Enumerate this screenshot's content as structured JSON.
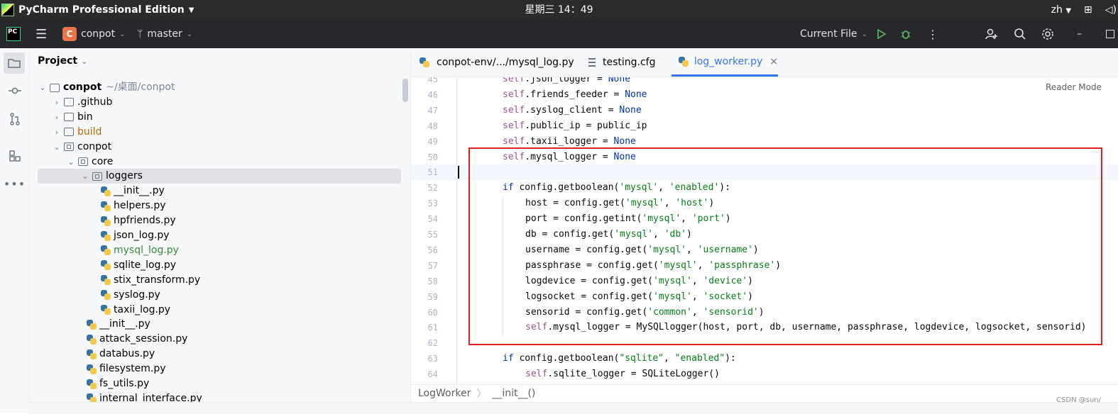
{
  "system_bar": {
    "app_title": "PyCharm Professional Edition",
    "clock": "星期三 14：49",
    "lang": "zh"
  },
  "toolbar": {
    "project_badge": "C",
    "project_name": "conpot",
    "branch": "master",
    "run_config": "Current File"
  },
  "project_panel": {
    "title": "Project",
    "tree": [
      {
        "label": "conpot",
        "note": "~/桌面/conpot",
        "kind": "folder",
        "level": 0,
        "state": "open"
      },
      {
        "label": ".github",
        "kind": "folder",
        "level": 1,
        "state": "closed"
      },
      {
        "label": "bin",
        "kind": "folder",
        "level": 1,
        "state": "closed"
      },
      {
        "label": "build",
        "kind": "folder",
        "level": 1,
        "state": "closed",
        "style": "orange"
      },
      {
        "label": "conpot",
        "kind": "package",
        "level": 1,
        "state": "open"
      },
      {
        "label": "core",
        "kind": "package",
        "level": 2,
        "state": "open"
      },
      {
        "label": "loggers",
        "kind": "package",
        "level": 3,
        "state": "open",
        "selected": true
      },
      {
        "label": "__init__.py",
        "kind": "py",
        "level": 4
      },
      {
        "label": "helpers.py",
        "kind": "py",
        "level": 4
      },
      {
        "label": "hpfriends.py",
        "kind": "py",
        "level": 4
      },
      {
        "label": "json_log.py",
        "kind": "py",
        "level": 4
      },
      {
        "label": "mysql_log.py",
        "kind": "py",
        "level": 4,
        "style": "green"
      },
      {
        "label": "sqlite_log.py",
        "kind": "py",
        "level": 4
      },
      {
        "label": "stix_transform.py",
        "kind": "py",
        "level": 4
      },
      {
        "label": "syslog.py",
        "kind": "py",
        "level": 4
      },
      {
        "label": "taxii_log.py",
        "kind": "py",
        "level": 4
      },
      {
        "label": "__init__.py",
        "kind": "py",
        "level": 3
      },
      {
        "label": "attack_session.py",
        "kind": "py",
        "level": 3
      },
      {
        "label": "databus.py",
        "kind": "py",
        "level": 3
      },
      {
        "label": "filesystem.py",
        "kind": "py",
        "level": 3
      },
      {
        "label": "fs_utils.py",
        "kind": "py",
        "level": 3
      },
      {
        "label": "internal_interface.py",
        "kind": "py",
        "level": 3
      }
    ]
  },
  "tabs": [
    {
      "label": "conpot-env/.../mysql_log.py",
      "icon": "python-file-icon"
    },
    {
      "label": "testing.cfg",
      "icon": "config-file-icon"
    },
    {
      "label": "log_worker.py",
      "icon": "python-file-icon",
      "active": true,
      "close": "×"
    }
  ],
  "editor": {
    "reader_mode": "Reader Mode",
    "current_line": 51,
    "lines": [
      {
        "num": "45",
        "indent": 0,
        "tokens": [
          [
            "sf",
            "self"
          ],
          [
            "",
            "."
          ],
          [
            "",
            "json_logger = "
          ],
          [
            "kw",
            "None"
          ]
        ]
      },
      {
        "num": "46",
        "indent": 0,
        "tokens": [
          [
            "sf",
            "self"
          ],
          [
            "",
            ".friends_feeder = "
          ],
          [
            "kw",
            "None"
          ]
        ]
      },
      {
        "num": "47",
        "indent": 0,
        "tokens": [
          [
            "sf",
            "self"
          ],
          [
            "",
            ".syslog_client = "
          ],
          [
            "kw",
            "None"
          ]
        ]
      },
      {
        "num": "48",
        "indent": 0,
        "tokens": [
          [
            "sf",
            "self"
          ],
          [
            "",
            ".public_ip = public_ip"
          ]
        ]
      },
      {
        "num": "49",
        "indent": 0,
        "tokens": [
          [
            "sf",
            "self"
          ],
          [
            "",
            ".taxii_logger = "
          ],
          [
            "kw",
            "None"
          ]
        ]
      },
      {
        "num": "50",
        "indent": 0,
        "tokens": [
          [
            "sf",
            "self"
          ],
          [
            "",
            ".mysql_logger = "
          ],
          [
            "kw",
            "None"
          ]
        ]
      },
      {
        "num": "51",
        "indent": 0,
        "tokens": []
      },
      {
        "num": "52",
        "indent": 0,
        "tokens": [
          [
            "kw",
            "if "
          ],
          [
            "",
            "config.getboolean("
          ],
          [
            "st",
            "'mysql'"
          ],
          [
            "",
            ", "
          ],
          [
            "st",
            "'enabled'"
          ],
          [
            "",
            "):"
          ]
        ]
      },
      {
        "num": "53",
        "indent": 1,
        "tokens": [
          [
            "",
            "host = config.get("
          ],
          [
            "st",
            "'mysql'"
          ],
          [
            "",
            ", "
          ],
          [
            "st",
            "'host'"
          ],
          [
            "",
            ")"
          ]
        ]
      },
      {
        "num": "54",
        "indent": 1,
        "tokens": [
          [
            "",
            "port = config.getint("
          ],
          [
            "st",
            "'mysql'"
          ],
          [
            "",
            ", "
          ],
          [
            "st",
            "'port'"
          ],
          [
            "",
            ")"
          ]
        ]
      },
      {
        "num": "55",
        "indent": 1,
        "tokens": [
          [
            "",
            "db = config.get("
          ],
          [
            "st",
            "'mysql'"
          ],
          [
            "",
            ", "
          ],
          [
            "st",
            "'db'"
          ],
          [
            "",
            ")"
          ]
        ]
      },
      {
        "num": "56",
        "indent": 1,
        "tokens": [
          [
            "",
            "username = config.get("
          ],
          [
            "st",
            "'mysql'"
          ],
          [
            "",
            ", "
          ],
          [
            "st",
            "'username'"
          ],
          [
            "",
            ")"
          ]
        ]
      },
      {
        "num": "57",
        "indent": 1,
        "tokens": [
          [
            "",
            "passphrase = config.get("
          ],
          [
            "st",
            "'mysql'"
          ],
          [
            "",
            ", "
          ],
          [
            "st",
            "'passphrase'"
          ],
          [
            "",
            ")"
          ]
        ]
      },
      {
        "num": "58",
        "indent": 1,
        "tokens": [
          [
            "",
            "logdevice = config.get("
          ],
          [
            "st",
            "'mysql'"
          ],
          [
            "",
            ", "
          ],
          [
            "st",
            "'device'"
          ],
          [
            "",
            ")"
          ]
        ]
      },
      {
        "num": "59",
        "indent": 1,
        "tokens": [
          [
            "",
            "logsocket = config.get("
          ],
          [
            "st",
            "'mysql'"
          ],
          [
            "",
            ", "
          ],
          [
            "st",
            "'socket'"
          ],
          [
            "",
            ")"
          ]
        ]
      },
      {
        "num": "60",
        "indent": 1,
        "tokens": [
          [
            "",
            "sensorid = config.get("
          ],
          [
            "st",
            "'common'"
          ],
          [
            "",
            ", "
          ],
          [
            "st",
            "'sensorid'"
          ],
          [
            "",
            ")"
          ]
        ]
      },
      {
        "num": "61",
        "indent": 1,
        "tokens": [
          [
            "sf",
            "self"
          ],
          [
            "",
            ".mysql_logger = MySQLlogger(host, port, db, username, passphrase, logdevice, logsocket, sensorid)"
          ]
        ]
      },
      {
        "num": "62",
        "indent": 0,
        "tokens": []
      },
      {
        "num": "63",
        "indent": 0,
        "tokens": [
          [
            "kw",
            "if "
          ],
          [
            "",
            "config.getboolean("
          ],
          [
            "st",
            "\"sqlite\""
          ],
          [
            "",
            ", "
          ],
          [
            "st",
            "\"enabled\""
          ],
          [
            "",
            "):"
          ]
        ]
      },
      {
        "num": "64",
        "indent": 1,
        "tokens": [
          [
            "sf",
            "self"
          ],
          [
            "",
            ".sqlite_logger = SQLiteLogger()"
          ]
        ]
      }
    ]
  },
  "breadcrumb": {
    "class_name": "LogWorker",
    "method_name": "__init__()"
  },
  "watermark": "CSDN @sun/",
  "colors": {
    "accent": "#3574f0",
    "highlight_box": "#e02020",
    "keyword": "#0033b3",
    "self": "#94558d",
    "string": "#067d17"
  }
}
